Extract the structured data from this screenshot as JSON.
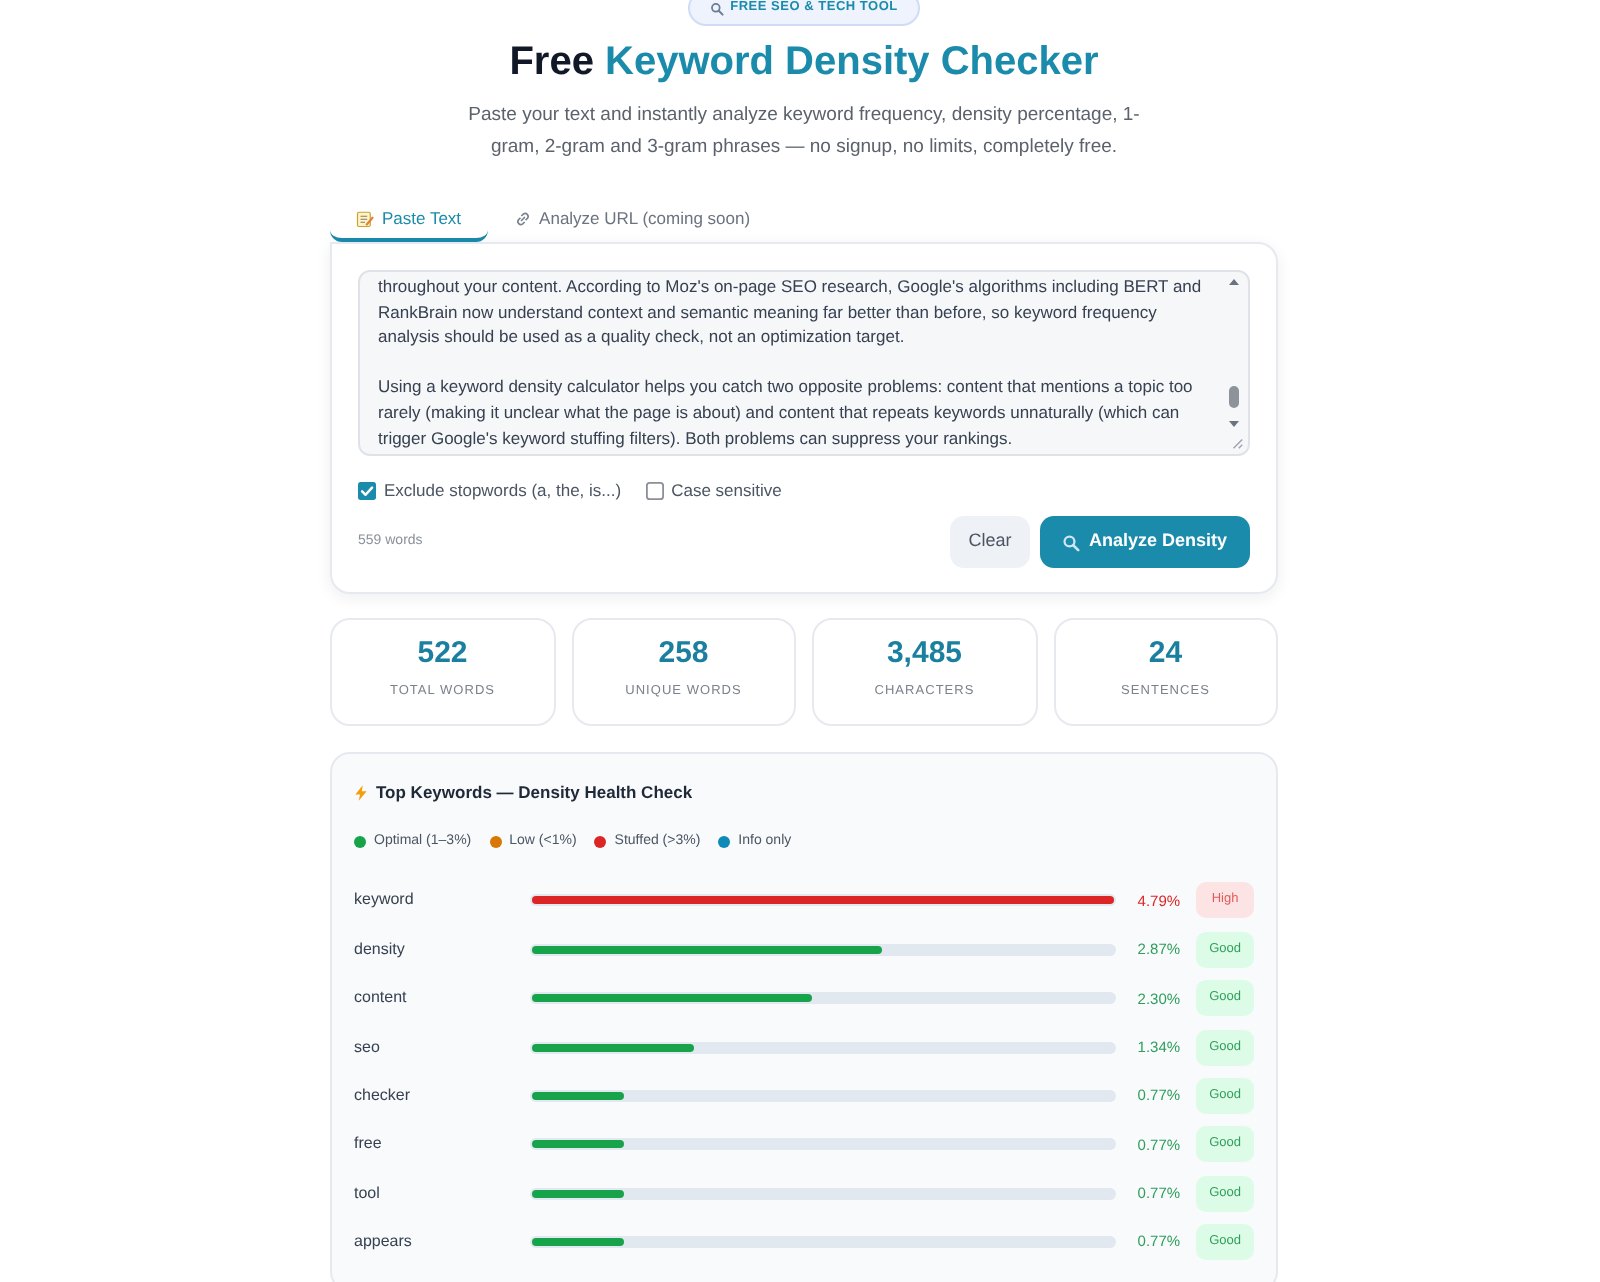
{
  "badge": {
    "text": "FREE SEO & TECH TOOL"
  },
  "title": [
    {
      "text": "Free",
      "accent": false
    },
    {
      "text": "Keyword Density Checker",
      "accent": true
    }
  ],
  "subtitle": "Paste your text and instantly analyze keyword frequency, density percentage, 1-gram, 2-gram and 3-gram phrases — no signup, no limits, completely free.",
  "tabs": [
    {
      "label": "Paste Text",
      "selected": true
    },
    {
      "label": "Analyze URL (coming soon)",
      "selected": false
    }
  ],
  "text_input": {
    "value": "throughout your content. According to Moz's on-page SEO research, Google's algorithms including BERT and RankBrain now understand context and semantic meaning far better than before, so keyword frequency analysis should be used as a quality check, not an optimization target.\n\nUsing a keyword density calculator helps you catch two opposite problems: content that mentions a topic too rarely (making it unclear what the page is about) and content that repeats keywords unnaturally (which can trigger Google's keyword stuffing filters). Both problems can suppress your rankings."
  },
  "options": [
    {
      "label": "Exclude stopwords (a, the, is...)",
      "checked": true
    },
    {
      "label": "Case sensitive",
      "checked": false
    }
  ],
  "word_count": "559 words",
  "buttons": [
    {
      "label": "Clear",
      "kind": "secondary"
    },
    {
      "label": "Analyze Density",
      "kind": "primary"
    }
  ],
  "stats": [
    {
      "value": "522",
      "label": "TOTAL WORDS"
    },
    {
      "value": "258",
      "label": "UNIQUE WORDS"
    },
    {
      "value": "3,485",
      "label": "CHARACTERS"
    },
    {
      "value": "24",
      "label": "SENTENCES"
    }
  ],
  "keywords_panel": {
    "title": "Top Keywords — Density Health Check",
    "legend": [
      {
        "label": "Optimal (1–3%)",
        "color": "#16a34a"
      },
      {
        "label": "Low (<1%)",
        "color": "#d97706"
      },
      {
        "label": "Stuffed (>3%)",
        "color": "#dc2626"
      },
      {
        "label": "Info only",
        "color": "#0e8ab8"
      }
    ],
    "rows": [
      {
        "keyword": "keyword",
        "level": 1.0,
        "density": "4.79%",
        "kind": "stuffed",
        "badge": "High"
      },
      {
        "keyword": "density",
        "level": 0.6,
        "density": "2.87%",
        "kind": "optimal",
        "badge": "Good"
      },
      {
        "keyword": "content",
        "level": 0.48,
        "density": "2.30%",
        "kind": "optimal",
        "badge": "Good"
      },
      {
        "keyword": "seo",
        "level": 0.28,
        "density": "1.34%",
        "kind": "optimal",
        "badge": "Good"
      },
      {
        "keyword": "checker",
        "level": 0.16,
        "density": "0.77%",
        "kind": "optimal",
        "badge": "Good"
      },
      {
        "keyword": "free",
        "level": 0.16,
        "density": "0.77%",
        "kind": "optimal",
        "badge": "Good"
      },
      {
        "keyword": "tool",
        "level": 0.16,
        "density": "0.77%",
        "kind": "optimal",
        "badge": "Good"
      },
      {
        "keyword": "appears",
        "level": 0.16,
        "density": "0.77%",
        "kind": "optimal",
        "badge": "Good"
      }
    ]
  }
}
